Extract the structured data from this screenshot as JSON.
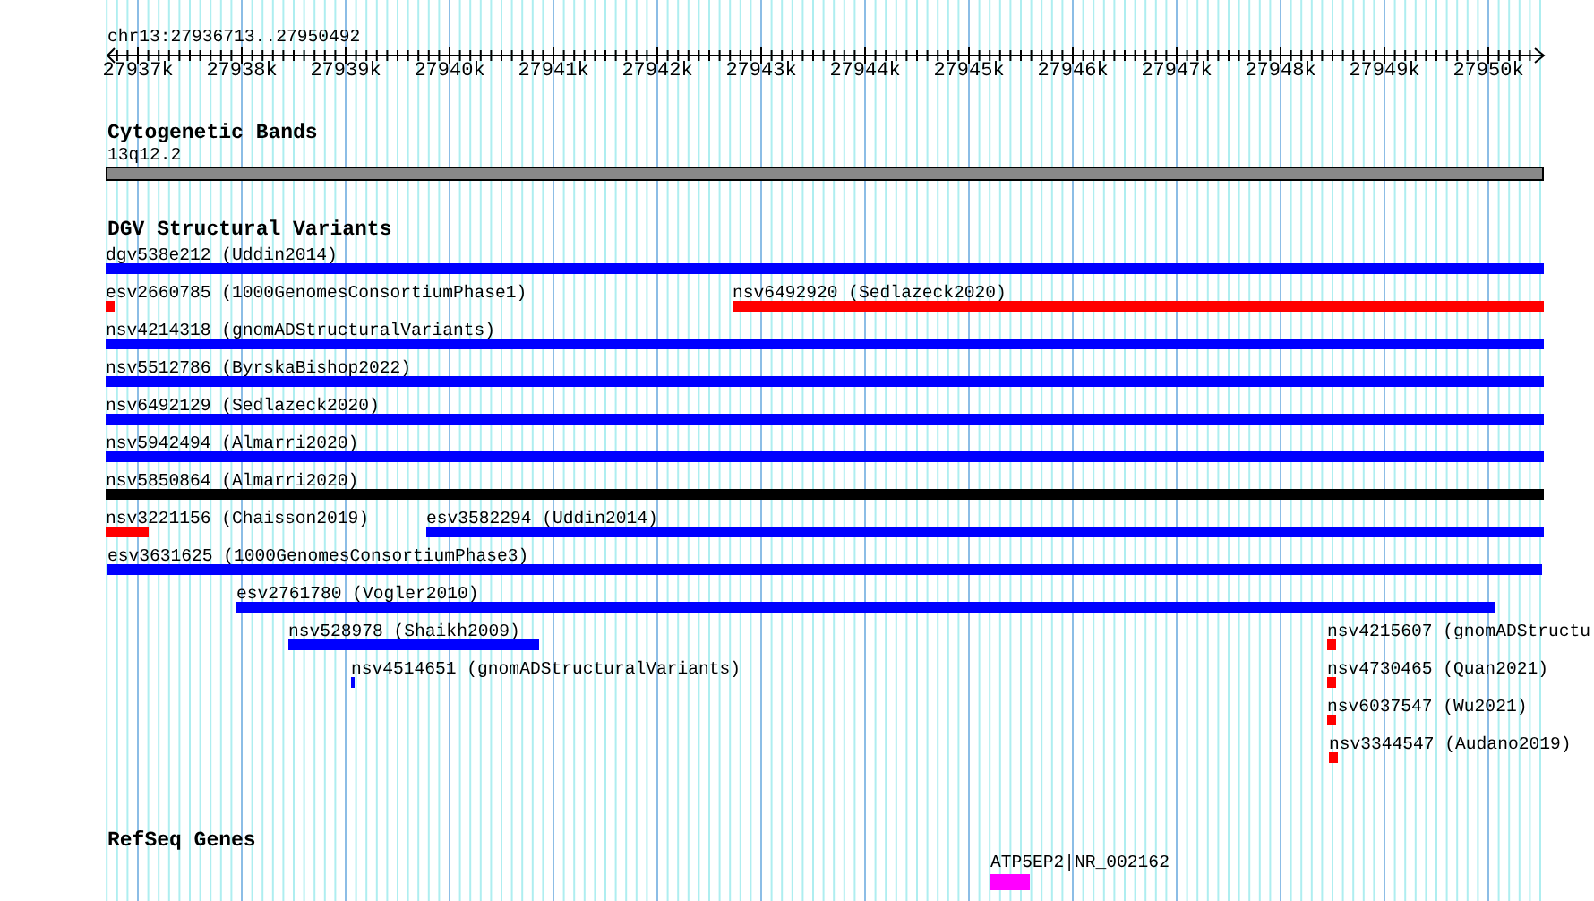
{
  "location": "chr13:27936713..27950492",
  "ruler": {
    "ticks": [
      "27937k",
      "27938k",
      "27939k",
      "27940k",
      "27941k",
      "27942k",
      "27943k",
      "27944k",
      "27945k",
      "27946k",
      "27947k",
      "27948k",
      "27949k",
      "27950k"
    ]
  },
  "tracks": [
    {
      "kind": "bands",
      "title": "Cytogenetic Bands",
      "features": [
        {
          "label": "13q12.2"
        }
      ]
    },
    {
      "kind": "variants",
      "title": "DGV Structural Variants",
      "rows": [
        [
          {
            "label": "dgv538e212 (Uddin2014)",
            "color": "#0000ff"
          }
        ],
        [
          {
            "label": "esv2660785 (1000GenomesConsortiumPhase1)",
            "color": "#ff0000"
          },
          {
            "label": "nsv6492920 (Sedlazeck2020)",
            "color": "#ff0000"
          }
        ],
        [
          {
            "label": "nsv4214318 (gnomADStructuralVariants)",
            "color": "#0000ff"
          }
        ],
        [
          {
            "label": "nsv5512786 (ByrskaBishop2022)",
            "color": "#0000ff"
          }
        ],
        [
          {
            "label": "nsv6492129 (Sedlazeck2020)",
            "color": "#0000ff"
          }
        ],
        [
          {
            "label": "nsv5942494 (Almarri2020)",
            "color": "#0000ff"
          }
        ],
        [
          {
            "label": "nsv5850864 (Almarri2020)",
            "color": "#000000"
          }
        ],
        [
          {
            "label": "nsv3221156 (Chaisson2019)",
            "color": "#ff0000"
          },
          {
            "label": "esv3582294 (Uddin2014)",
            "color": "#0000ff"
          }
        ],
        [
          {
            "label": "esv3631625 (1000GenomesConsortiumPhase3)",
            "color": "#0000ff"
          }
        ],
        [
          {
            "label": "esv2761780 (Vogler2010)",
            "color": "#0000ff"
          }
        ],
        [
          {
            "label": "nsv528978 (Shaikh2009)",
            "color": "#0000ff"
          },
          {
            "label": "nsv4215607 (gnomADStructu",
            "color": "#ff0000"
          }
        ],
        [
          {
            "label": "nsv4514651 (gnomADStructuralVariants)",
            "color": "#0000ff"
          },
          {
            "label": "nsv4730465 (Quan2021)",
            "color": "#ff0000"
          }
        ],
        [
          {
            "label": "nsv6037547 (Wu2021)",
            "color": "#ff0000"
          }
        ],
        [
          {
            "label": "nsv3344547 (Audano2019)",
            "color": "#ff0000"
          }
        ]
      ]
    },
    {
      "kind": "genes",
      "title": "RefSeq Genes",
      "features": [
        {
          "label": "ATP5EP2|NR_002162",
          "color": "#ff00ff"
        }
      ]
    }
  ]
}
